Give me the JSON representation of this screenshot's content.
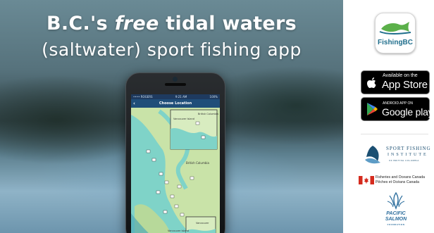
{
  "hero": {
    "title_prefix": "B.C.'s",
    "title_emphasis": "free",
    "title_suffix": "tidal waters",
    "subtitle": "(saltwater) sport fishing app"
  },
  "phone": {
    "status_carrier": "•••• ROGERS",
    "status_time": "9:21 AM",
    "status_battery": "100%",
    "nav_title": "Choose Location",
    "map_labels": [
      "Vancouver Island",
      "British Columbia",
      "British Columbia",
      "Vancouver",
      "Vancouver Island"
    ]
  },
  "app": {
    "name": "FishingBC"
  },
  "badges": {
    "apple_small": "Available on the",
    "apple_big": "App Store",
    "google_small": "ANDROID APP ON",
    "google_big": "Google play"
  },
  "partners": {
    "sfi_line1": "SPORT FISHING",
    "sfi_line2": "INSTITUTE",
    "sfi_line3": "OF BRITISH COLUMBIA",
    "dfo_en": "Fisheries and Oceans Canada",
    "dfo_fr": "Pêches et Océans Canada",
    "psf_line1": "PACIFIC",
    "psf_line2": "SALMON",
    "psf_line3": "FOUNDATION"
  },
  "colors": {
    "nav_blue": "#1f4e79",
    "sea_teal": "#7fd3c8",
    "land_green": "#c9e3a8",
    "brand_teal": "#1f6e8c"
  }
}
